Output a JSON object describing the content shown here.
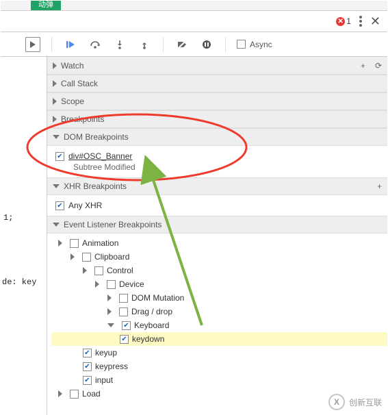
{
  "top_tab": {
    "label": "动弹"
  },
  "top_right": {
    "error_count": "1",
    "menu_name": "menu",
    "close_name": "close"
  },
  "toolbar": {
    "record_name": "record",
    "resume_name": "resume-script",
    "step_over_name": "step-over",
    "step_into_name": "step-into",
    "step_out_name": "step-out",
    "deactivate_name": "deactivate-breakpoints",
    "pause_exceptions_name": "pause-on-exceptions",
    "async_label": "Async"
  },
  "code_pane": {
    "snip1": "1;",
    "snip2": "de: key"
  },
  "sections": {
    "watch": {
      "title": "Watch"
    },
    "call_stack": {
      "title": "Call Stack"
    },
    "scope": {
      "title": "Scope"
    },
    "breakpoints": {
      "title": "Breakpoints"
    },
    "dom_breakpoints": {
      "title": "DOM Breakpoints",
      "entry_selector": "div#OSC_Banner",
      "entry_type": "Subtree Modified"
    },
    "xhr_breakpoints": {
      "title": "XHR Breakpoints",
      "any_xhr_label": "Any XHR"
    },
    "event_listener_breakpoints": {
      "title": "Event Listener Breakpoints",
      "tree": {
        "animation": "Animation",
        "clipboard": "Clipboard",
        "control": "Control",
        "device": "Device",
        "dom_mutation": "DOM Mutation",
        "drag_drop": "Drag / drop",
        "keyboard": "Keyboard",
        "keydown": "keydown",
        "keyup": "keyup",
        "keypress": "keypress",
        "input": "input",
        "load": "Load"
      }
    }
  },
  "watermark": {
    "text": "创新互联",
    "logo_text": "X"
  },
  "plus_icon": "+",
  "refresh_icon": "⟳"
}
